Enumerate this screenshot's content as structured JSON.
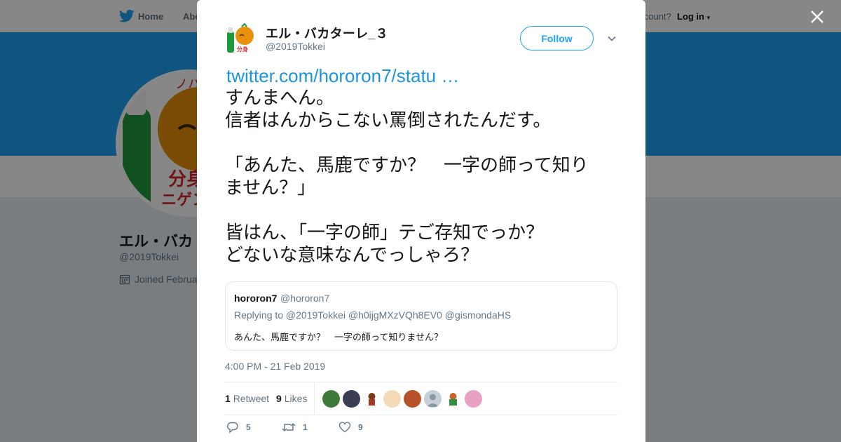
{
  "background_page": {
    "nav": {
      "home": "Home",
      "about": "Abo"
    },
    "account": {
      "prompt": "account?",
      "login": "Log in"
    },
    "profile": {
      "name": "エル・バカ",
      "handle": "@2019Tokkei",
      "joined": "Joined Februa"
    }
  },
  "tweet": {
    "author": {
      "display_name": "エル・バカターレ_３",
      "handle": "@2019Tokkei"
    },
    "follow_label": "Follow",
    "link": "twitter.com/hororon7/statu …",
    "lines": [
      "すんまへん。",
      "信者はんからこない罵倒されたんだす。",
      "",
      "「あんた、馬鹿ですか？　一字の師って知り",
      "ません？」",
      "",
      "皆はん、「一字の師」テご存知でっか？",
      "どないな意味なんでっしゃろ？"
    ],
    "quoted": {
      "name": "hororon7",
      "handle": "@hororon7",
      "replying": "Replying to @2019Tokkei @h0ijgMXzVQh8EV0 @gismondaHS",
      "text": "あんた、馬鹿ですか？　一字の師って知りません？"
    },
    "timestamp": "4:00 PM - 21 Feb 2019",
    "stats": {
      "retweets_count": "1",
      "retweets_label": "Retweet",
      "likes_count": "9",
      "likes_label": "Likes"
    },
    "actions": {
      "reply_count": "5",
      "retweet_count": "1",
      "like_count": "9"
    }
  },
  "icons": [
    "twitter-bird-icon",
    "close-icon",
    "chevron-down-icon",
    "calendar-icon",
    "reply-icon",
    "retweet-icon",
    "heart-icon"
  ],
  "colors": {
    "accent": "#1da1f2",
    "link": "#1b95e0",
    "text": "#14171a",
    "muted": "#657786",
    "overlay": "rgba(0,0,0,0.47)"
  }
}
